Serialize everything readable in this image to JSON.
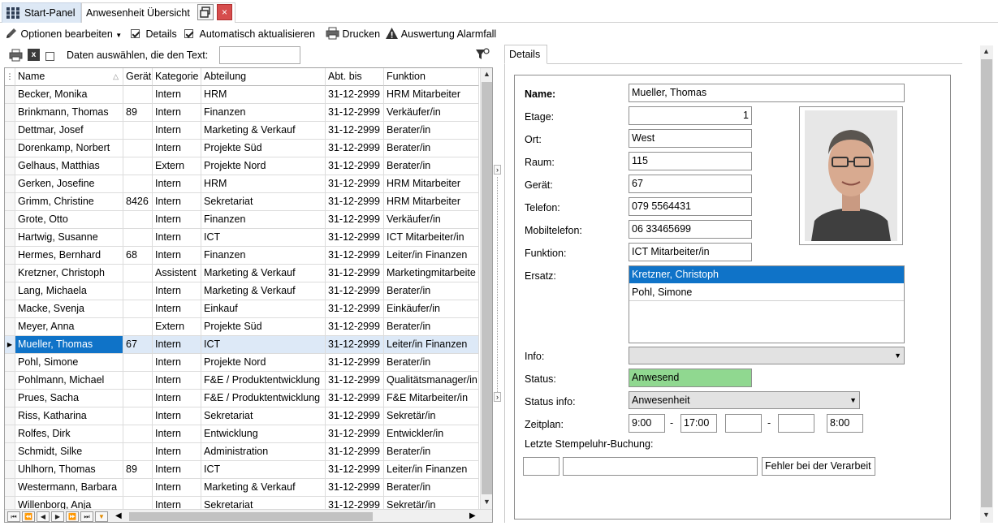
{
  "tabs": {
    "start_label": "Start-Panel",
    "active_label": "Anwesenheit Übersicht",
    "close_glyph": "×"
  },
  "toolbar": {
    "options_label": "Optionen bearbeiten",
    "details_label": "Details",
    "details_checked": true,
    "auto_label": "Automatisch aktualisieren",
    "auto_checked": true,
    "print_label": "Drucken",
    "alarm_label": "Auswertung Alarmfall"
  },
  "filterbar": {
    "select_text_label": "Daten auswählen, die den Text:",
    "filter_value": "",
    "excel_icon_text": "x"
  },
  "grid": {
    "columns": [
      "Name",
      "Gerät",
      "Kategorie",
      "Abteilung",
      "Abt. bis",
      "Funktion"
    ],
    "rows": [
      {
        "name": "Becker, Monika",
        "geraet": "",
        "kategorie": "Intern",
        "abteilung": "HRM",
        "bis": "31-12-2999",
        "funktion": "HRM Mitarbeiter"
      },
      {
        "name": "Brinkmann, Thomas",
        "geraet": "89",
        "kategorie": "Intern",
        "abteilung": "Finanzen",
        "bis": "31-12-2999",
        "funktion": "Verkäufer/in"
      },
      {
        "name": "Dettmar, Josef",
        "geraet": "",
        "kategorie": "Intern",
        "abteilung": "Marketing & Verkauf",
        "bis": "31-12-2999",
        "funktion": "Berater/in"
      },
      {
        "name": "Dorenkamp, Norbert",
        "geraet": "",
        "kategorie": "Intern",
        "abteilung": "Projekte Süd",
        "bis": "31-12-2999",
        "funktion": "Berater/in"
      },
      {
        "name": "Gelhaus, Matthias",
        "geraet": "",
        "kategorie": "Extern",
        "abteilung": "Projekte Nord",
        "bis": "31-12-2999",
        "funktion": "Berater/in"
      },
      {
        "name": "Gerken, Josefine",
        "geraet": "",
        "kategorie": "Intern",
        "abteilung": "HRM",
        "bis": "31-12-2999",
        "funktion": "HRM Mitarbeiter"
      },
      {
        "name": "Grimm, Christine",
        "geraet": "8426",
        "kategorie": "Intern",
        "abteilung": "Sekretariat",
        "bis": "31-12-2999",
        "funktion": "HRM Mitarbeiter"
      },
      {
        "name": "Grote, Otto",
        "geraet": "",
        "kategorie": "Intern",
        "abteilung": "Finanzen",
        "bis": "31-12-2999",
        "funktion": "Verkäufer/in"
      },
      {
        "name": "Hartwig, Susanne",
        "geraet": "",
        "kategorie": "Intern",
        "abteilung": "ICT",
        "bis": "31-12-2999",
        "funktion": "ICT Mitarbeiter/in"
      },
      {
        "name": "Hermes, Bernhard",
        "geraet": "68",
        "kategorie": "Intern",
        "abteilung": "Finanzen",
        "bis": "31-12-2999",
        "funktion": "Leiter/in Finanzen"
      },
      {
        "name": "Kretzner, Christoph",
        "geraet": "",
        "kategorie": "Assistent",
        "abteilung": "Marketing & Verkauf",
        "bis": "31-12-2999",
        "funktion": "Marketingmitarbeite"
      },
      {
        "name": "Lang, Michaela",
        "geraet": "",
        "kategorie": "Intern",
        "abteilung": "Marketing & Verkauf",
        "bis": "31-12-2999",
        "funktion": "Berater/in"
      },
      {
        "name": "Macke, Svenja",
        "geraet": "",
        "kategorie": "Intern",
        "abteilung": "Einkauf",
        "bis": "31-12-2999",
        "funktion": "Einkäufer/in"
      },
      {
        "name": "Meyer, Anna",
        "geraet": "",
        "kategorie": "Extern",
        "abteilung": "Projekte Süd",
        "bis": "31-12-2999",
        "funktion": "Berater/in"
      },
      {
        "name": "Mueller, Thomas",
        "geraet": "67",
        "kategorie": "Intern",
        "abteilung": "ICT",
        "bis": "31-12-2999",
        "funktion": "Leiter/in Finanzen",
        "selected": true
      },
      {
        "name": "Pohl, Simone",
        "geraet": "",
        "kategorie": "Intern",
        "abteilung": "Projekte Nord",
        "bis": "31-12-2999",
        "funktion": "Berater/in"
      },
      {
        "name": "Pohlmann, Michael",
        "geraet": "",
        "kategorie": "Intern",
        "abteilung": "F&E / Produktentwicklung",
        "bis": "31-12-2999",
        "funktion": "Qualitätsmanager/in"
      },
      {
        "name": "Prues, Sacha",
        "geraet": "",
        "kategorie": "Intern",
        "abteilung": "F&E / Produktentwicklung",
        "bis": "31-12-2999",
        "funktion": "F&E Mitarbeiter/in"
      },
      {
        "name": "Riss, Katharina",
        "geraet": "",
        "kategorie": "Intern",
        "abteilung": "Sekretariat",
        "bis": "31-12-2999",
        "funktion": "Sekretär/in"
      },
      {
        "name": "Rolfes, Dirk",
        "geraet": "",
        "kategorie": "Intern",
        "abteilung": "Entwicklung",
        "bis": "31-12-2999",
        "funktion": "Entwickler/in"
      },
      {
        "name": "Schmidt, Silke",
        "geraet": "",
        "kategorie": "Intern",
        "abteilung": "Administration",
        "bis": "31-12-2999",
        "funktion": "Berater/in"
      },
      {
        "name": "Uhlhorn, Thomas",
        "geraet": "89",
        "kategorie": "Intern",
        "abteilung": "ICT",
        "bis": "31-12-2999",
        "funktion": "Leiter/in Finanzen"
      },
      {
        "name": "Westermann, Barbara",
        "geraet": "",
        "kategorie": "Intern",
        "abteilung": "Marketing & Verkauf",
        "bis": "31-12-2999",
        "funktion": "Berater/in"
      },
      {
        "name": "Willenborg, Anja",
        "geraet": "",
        "kategorie": "Intern",
        "abteilung": "Sekretariat",
        "bis": "31-12-2999",
        "funktion": "Sekretär/in"
      }
    ]
  },
  "details": {
    "tab_label": "Details",
    "labels": {
      "name": "Name:",
      "etage": "Etage:",
      "ort": "Ort:",
      "raum": "Raum:",
      "geraet": "Gerät:",
      "telefon": "Telefon:",
      "mobil": "Mobiltelefon:",
      "funktion": "Funktion:",
      "ersatz": "Ersatz:",
      "info": "Info:",
      "status": "Status:",
      "status_info": "Status info:",
      "zeitplan": "Zeitplan:",
      "stempel": "Letzte Stempeluhr-Buchung:"
    },
    "values": {
      "name": "Mueller, Thomas",
      "etage": "1",
      "ort": "West",
      "raum": "115",
      "geraet": "67",
      "telefon": "079 5564431",
      "mobil": "06 33465699",
      "funktion": "ICT Mitarbeiter/in",
      "ersatz": [
        "Kretzner, Christoph",
        "Pohl, Simone"
      ],
      "info": "",
      "status": "Anwesend",
      "status_info": "Anwesenheit",
      "zeit_von1": "9:00",
      "zeit_bis1": "17:00",
      "zeit_von2": "",
      "zeit_bis2": "",
      "zeit_total": "8:00",
      "dash": "-",
      "stempel_1": "",
      "stempel_2": "",
      "stempel_error": "Fehler bei der Verarbeit"
    },
    "status_color": "#90d890",
    "selection_color": "#0f73c8"
  }
}
